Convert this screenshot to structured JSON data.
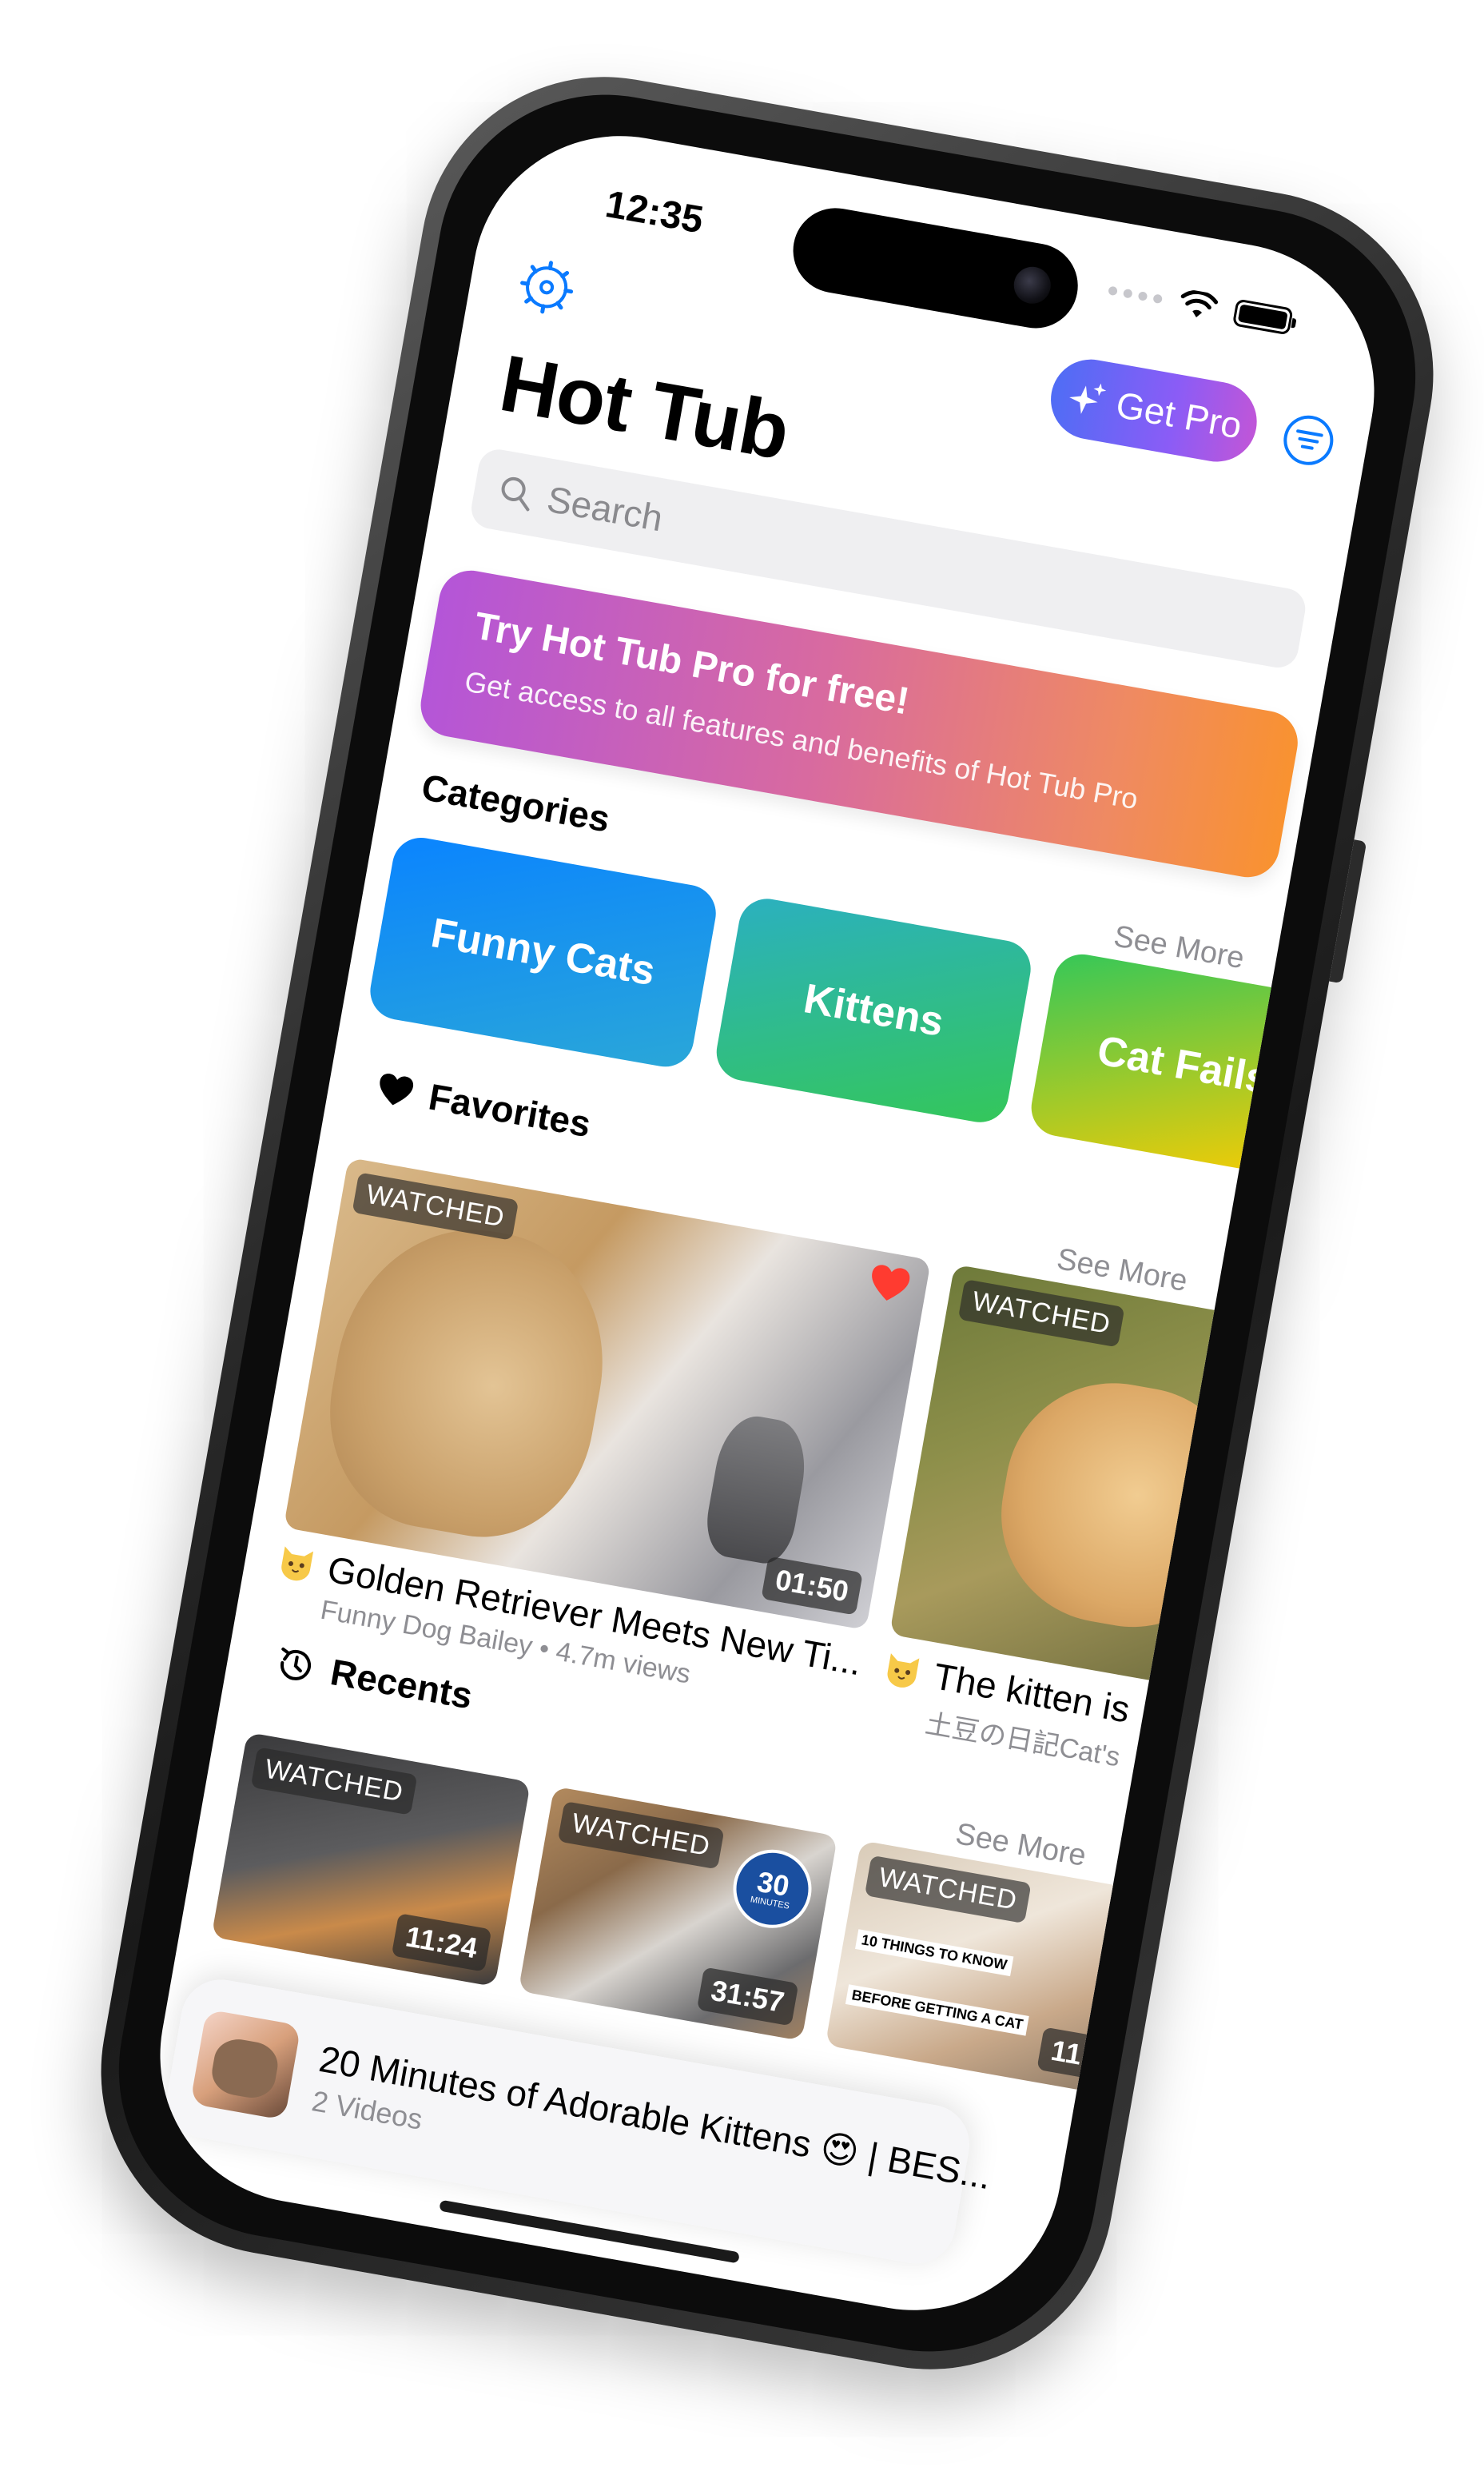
{
  "status_bar": {
    "time": "12:35"
  },
  "header": {
    "settings_icon": "gear-icon",
    "get_pro_label": "Get Pro",
    "filter_icon": "filter-icon",
    "title": "Hot Tub"
  },
  "search": {
    "placeholder": "Search"
  },
  "promo": {
    "title": "Try Hot Tub Pro for free!",
    "subtitle": "Get access to all features and benefits of Hot Tub Pro"
  },
  "categories": {
    "label": "Categories",
    "see_more": "See More",
    "items": [
      {
        "label": "Funny Cats"
      },
      {
        "label": "Kittens"
      },
      {
        "label": "Cat Fails"
      }
    ]
  },
  "favorites": {
    "label": "Favorites",
    "see_more": "See More",
    "items": [
      {
        "badge": "WATCHED",
        "duration": "01:50",
        "title": "Golden Retriever Meets New Ti...",
        "channel": "Funny Dog Bailey",
        "views": "4.7m views"
      },
      {
        "badge": "WATCHED",
        "title": "The kitten is",
        "channel": "土豆の日記Cat's"
      }
    ]
  },
  "recents": {
    "label": "Recents",
    "see_more": "See More",
    "items": [
      {
        "badge": "WATCHED",
        "duration": "11:24"
      },
      {
        "badge": "WATCHED",
        "duration": "31:57",
        "thumb_text": "30",
        "thumb_text2": "MINUTES"
      },
      {
        "badge": "WATCHED",
        "duration": "11:",
        "thumb_text": "10 THINGS TO KNOW",
        "thumb_text2": "BEFORE GETTING A CAT"
      }
    ]
  },
  "now_playing": {
    "title": "20 Minutes of Adorable Kittens 😍 | BES...",
    "subtitle": "2 Videos"
  },
  "colors": {
    "accent": "#0a7aff",
    "pro_gradient_start": "#4f6df5",
    "pro_gradient_end": "#c056d8",
    "favorite_heart": "#ff3b30"
  }
}
